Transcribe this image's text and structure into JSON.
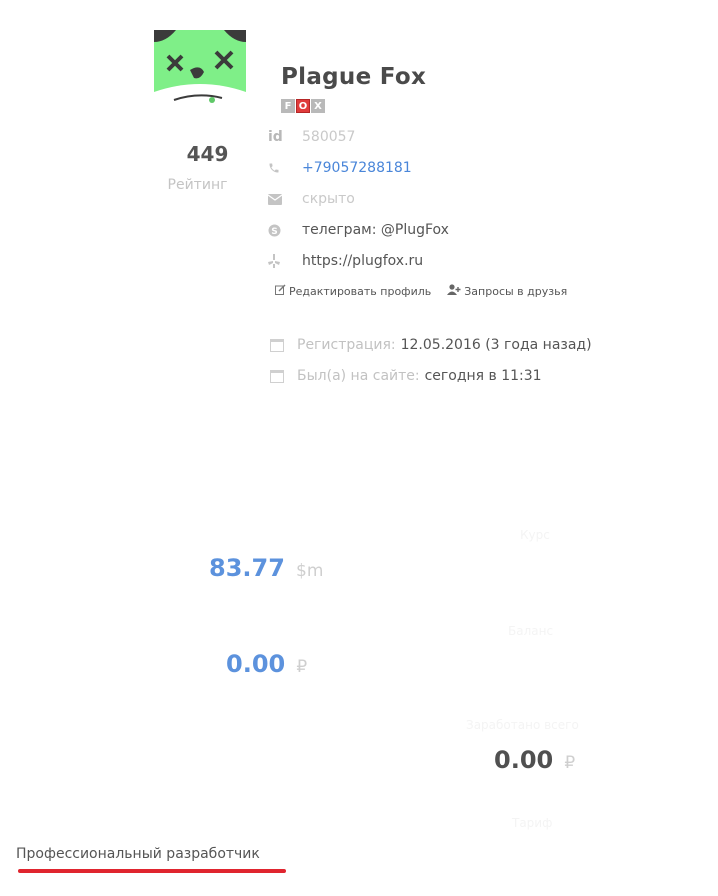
{
  "profile": {
    "name": "Plague Fox",
    "badges": [
      "F",
      "O",
      "X"
    ],
    "rating": {
      "value": "449",
      "label": "Рейтинг"
    }
  },
  "info": {
    "id_label": "id",
    "id": "580057",
    "phone": "+79057288181",
    "email": "скрыто",
    "skype": "телеграм: @PlugFox",
    "website": "https://plugfox.ru"
  },
  "actions": {
    "edit": "Редактировать профиль",
    "friends": "Запросы в друзья"
  },
  "dates": {
    "registration_label": "Регистрация:",
    "registration_value": "12.05.2016 (3 года назад)",
    "last_seen_label": "Был(а) на сайте:",
    "last_seen_value": "сегодня в 11:31"
  },
  "balances": {
    "sm_value": "83.77",
    "sm_unit": "$m",
    "rub_value": "0.00",
    "rub_unit": "₽",
    "right_value": "0.00",
    "right_unit": "₽"
  },
  "faint_labels": [
    "Курс",
    "Баланс",
    "Заработано всего",
    "Тариф"
  ],
  "specialization": "Профессиональный разработчик",
  "colors": {
    "avatar_green": "#7fef88",
    "avatar_dark": "#3b3b3b",
    "link_blue": "#4a86d9",
    "amount_blue": "#5c92dd",
    "underline_red": "#e0252f"
  }
}
